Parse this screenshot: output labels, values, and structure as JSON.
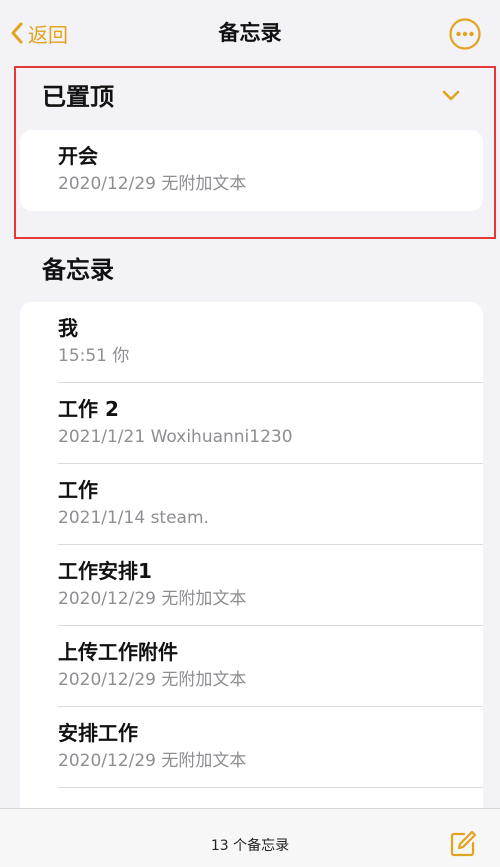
{
  "nav": {
    "back_label": "返回",
    "title": "备忘录"
  },
  "pinned": {
    "section_title": "已置顶",
    "notes": [
      {
        "title": "开会",
        "subtitle": "2020/12/29  无附加文本"
      }
    ]
  },
  "notes": {
    "section_title": "备忘录",
    "items": [
      {
        "title": "我",
        "subtitle": "15:51  你"
      },
      {
        "title": "工作 2",
        "subtitle": "2021/1/21  Woxihuanni1230"
      },
      {
        "title": "工作",
        "subtitle": "2021/1/14  steam."
      },
      {
        "title": "工作安排1",
        "subtitle": "2020/12/29  无附加文本"
      },
      {
        "title": "上传工作附件",
        "subtitle": "2020/12/29  无附加文本"
      },
      {
        "title": "安排工作",
        "subtitle": "2020/12/29  无附加文本"
      }
    ]
  },
  "toolbar": {
    "count_label": "13 个备忘录"
  },
  "colors": {
    "accent": "#e2a31d",
    "background": "#f2f2f7",
    "annotation": "#e53935",
    "secondary_text": "#8e8e93"
  },
  "icons": {
    "back": "chevron-left-icon",
    "more": "ellipsis-circle-icon",
    "collapse": "chevron-down-icon",
    "compose": "compose-icon"
  }
}
